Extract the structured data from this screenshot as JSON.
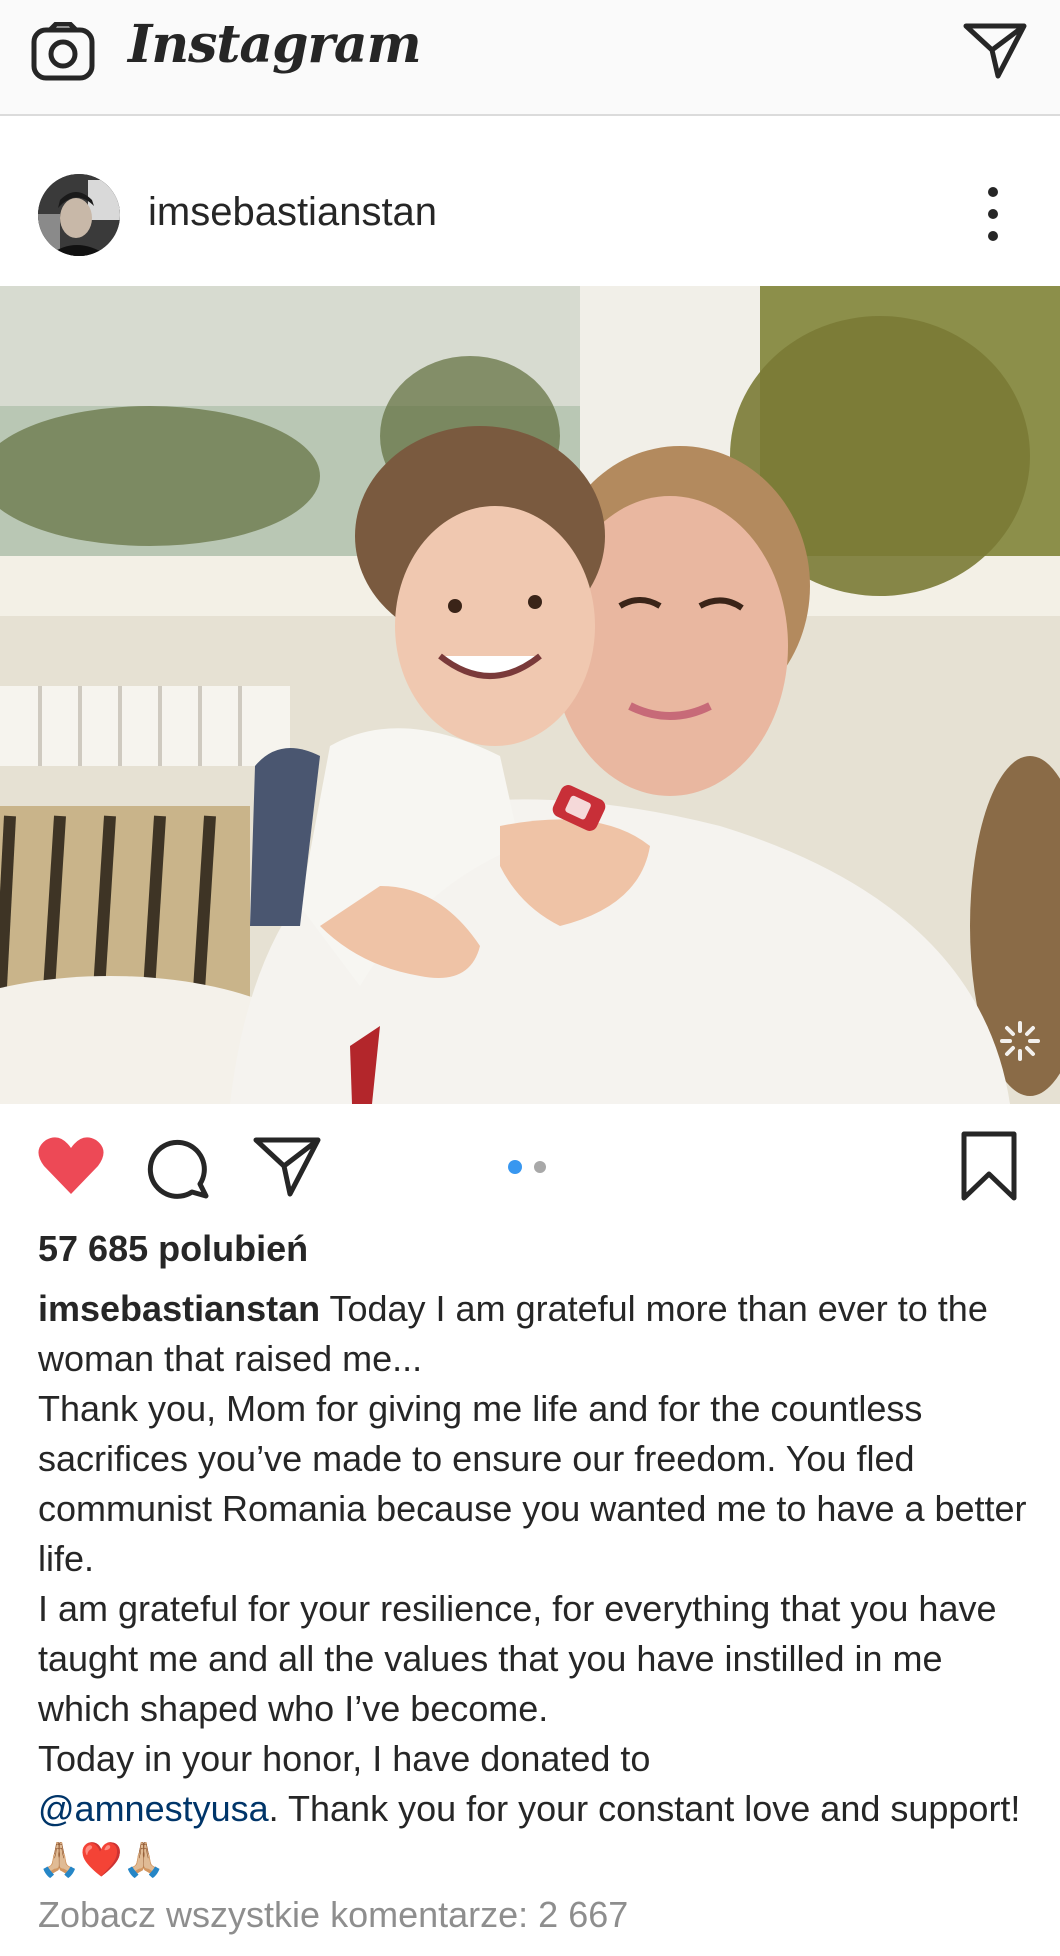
{
  "app": {
    "wordmark": "Instagram"
  },
  "post": {
    "username": "imsebastianstan",
    "likes_text": "57 685 polubień",
    "carousel": {
      "count": 2,
      "active_index": 0
    },
    "liked": true,
    "caption": {
      "author": "imsebastianstan",
      "lines": [
        "Today I am grateful more than ever to the woman that raised me...",
        "Thank you, Mom for giving me life and for the countless sacrifices you’ve made to ensure our freedom. You fled communist Romania because you wanted me to have a better life.",
        "I am grateful for your resilience, for everything that you have taught me and all the values that you have instilled in me which shaped who I’ve become.",
        "Today in your honor, I have donated to"
      ],
      "mention": "@amnestyusa",
      "closing": ". Thank you for your constant love and support! ",
      "emojis": "🙏🏼❤️🙏🏼"
    },
    "view_comments_text": "Zobacz wszystkie komentarze: 2 667"
  },
  "icons": {
    "camera": "camera-icon",
    "direct": "direct-message-icon",
    "more": "more-options-icon",
    "like": "heart-icon",
    "comment": "comment-icon",
    "share": "share-icon",
    "save": "bookmark-icon"
  },
  "colors": {
    "like_active": "#ed4956",
    "mention": "#003569",
    "muted": "#8e8e8e",
    "carousel_active": "#3897f0"
  }
}
